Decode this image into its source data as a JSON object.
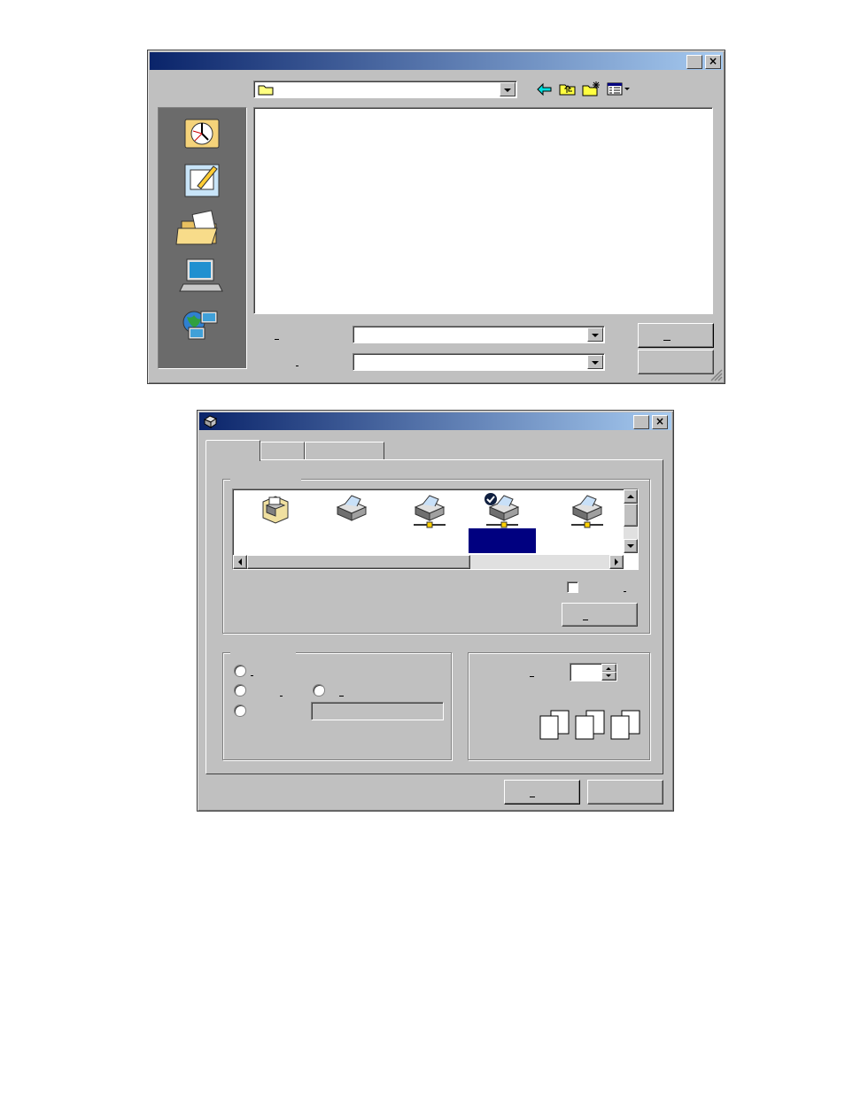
{
  "open_dialog": {
    "title": "",
    "look_in_value": "",
    "file_name_label": "",
    "file_type_label": "",
    "file_name_value": "",
    "file_type_value": "",
    "ok_label": "",
    "cancel_label": "",
    "places_icons": [
      "history-icon",
      "desktop-icon",
      "my-documents-icon",
      "my-computer-icon",
      "network-places-icon"
    ],
    "toolbar_icons": [
      "back-arrow-icon",
      "up-folder-icon",
      "new-folder-icon",
      "view-menu-icon"
    ]
  },
  "print_dialog": {
    "title": "",
    "tabs": [
      "",
      "",
      ""
    ],
    "printer_group_label": "",
    "printers": [
      {
        "name": "",
        "icon": "add-printer-icon"
      },
      {
        "name": "",
        "icon": "printer-icon"
      },
      {
        "name": "",
        "icon": "network-printer-icon"
      },
      {
        "name": "",
        "icon": "default-printer-icon",
        "selected": true
      },
      {
        "name": "",
        "icon": "network-printer-icon"
      }
    ],
    "print_to_file_label": "",
    "find_printer_label": "",
    "page_range_label": "",
    "range_all_label": "",
    "range_selection_label": "",
    "range_current_label": "",
    "range_pages_label": "",
    "pages_value": "",
    "copies_label": "",
    "copies_value": "",
    "collate_label": "",
    "print_button_label": "",
    "cancel_button_label": ""
  },
  "colors": {
    "title_start": "#0a246a",
    "title_end": "#a6caf0",
    "face": "#c0c0c0",
    "selection": "#000080"
  }
}
